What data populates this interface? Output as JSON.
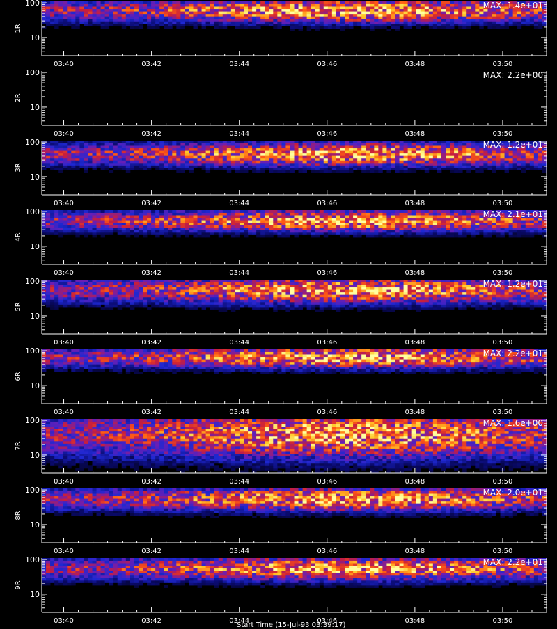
{
  "chart_data": [
    {
      "type": "heatmap",
      "panel": "1R",
      "max_label": "MAX: 1.4e+01",
      "max": 14,
      "band_peak": 60,
      "band_width": 0.22,
      "empty": false,
      "yticks": [
        "100",
        "10"
      ],
      "xticks": [
        "03:40",
        "03:42",
        "03:44",
        "03:46",
        "03:48",
        "03:50"
      ]
    },
    {
      "type": "heatmap",
      "panel": "2R",
      "max_label": "MAX: 2.2e+00",
      "max": 2.2,
      "band_peak": 50,
      "band_width": 0.2,
      "empty": true,
      "yticks": [
        "100",
        "10"
      ],
      "xticks": [
        "03:40",
        "03:42",
        "03:44",
        "03:46",
        "03:48",
        "03:50"
      ]
    },
    {
      "type": "heatmap",
      "panel": "3R",
      "max_label": "MAX: 1.2e+01",
      "max": 12,
      "band_peak": 45,
      "band_width": 0.22,
      "empty": false,
      "yticks": [
        "100",
        "10"
      ],
      "xticks": [
        "03:40",
        "03:42",
        "03:44",
        "03:46",
        "03:48",
        "03:50"
      ]
    },
    {
      "type": "heatmap",
      "panel": "4R",
      "max_label": "MAX: 2.1e+01",
      "max": 21,
      "band_peak": 55,
      "band_width": 0.2,
      "empty": false,
      "yticks": [
        "100",
        "10"
      ],
      "xticks": [
        "03:40",
        "03:42",
        "03:44",
        "03:46",
        "03:48",
        "03:50"
      ]
    },
    {
      "type": "heatmap",
      "panel": "5R",
      "max_label": "MAX: 1.2e+01",
      "max": 12,
      "band_peak": 55,
      "band_width": 0.24,
      "empty": false,
      "yticks": [
        "100",
        "10"
      ],
      "xticks": [
        "03:40",
        "03:42",
        "03:44",
        "03:46",
        "03:48",
        "03:50"
      ]
    },
    {
      "type": "heatmap",
      "panel": "6R",
      "max_label": "MAX: 2.2e+01",
      "max": 22,
      "band_peak": 65,
      "band_width": 0.2,
      "empty": false,
      "yticks": [
        "100",
        "10"
      ],
      "xticks": [
        "03:40",
        "03:42",
        "03:44",
        "03:46",
        "03:48",
        "03:50"
      ]
    },
    {
      "type": "heatmap",
      "panel": "7R",
      "max_label": "MAX: 1.6e+00",
      "max": 1.6,
      "band_peak": 40,
      "band_width": 0.45,
      "empty": false,
      "yticks": [
        "100",
        "10"
      ],
      "xticks": [
        "03:40",
        "03:42",
        "03:44",
        "03:46",
        "03:48",
        "03:50"
      ]
    },
    {
      "type": "heatmap",
      "panel": "8R",
      "max_label": "MAX: 2.0e+01",
      "max": 20,
      "band_peak": 55,
      "band_width": 0.22,
      "empty": false,
      "yticks": [
        "100",
        "10"
      ],
      "xticks": [
        "03:40",
        "03:42",
        "03:44",
        "03:46",
        "03:48",
        "03:50"
      ]
    },
    {
      "type": "heatmap",
      "panel": "9R",
      "max_label": "MAX: 2.2e+01",
      "max": 22,
      "band_peak": 55,
      "band_width": 0.22,
      "empty": false,
      "yticks": [
        "100",
        "10"
      ],
      "xticks": [
        "03:40",
        "03:42",
        "03:44",
        "03:46",
        "03:48",
        "03:50"
      ]
    }
  ],
  "shared": {
    "x_range": [
      "03:39:30",
      "03:51:00"
    ],
    "y_range": [
      3,
      110
    ],
    "y_scale": "log",
    "colormap": [
      "#000000",
      "#0a0a6e",
      "#1e28d2",
      "#6a1eb4",
      "#c81e3c",
      "#ff5a14",
      "#ffc828",
      "#ffffa0"
    ],
    "xlabel": "Start Time (15-Jul-93 03:39:17)",
    "grid": false
  }
}
